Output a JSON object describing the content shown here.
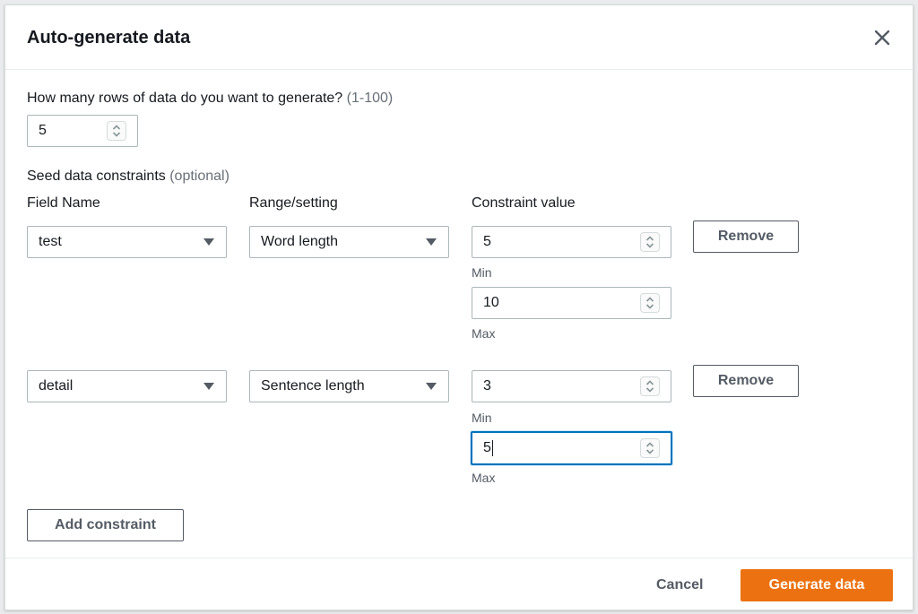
{
  "modal": {
    "title": "Auto-generate data",
    "close_icon": "close-icon"
  },
  "rows": {
    "question": "How many rows of data do you want to generate?",
    "range_hint": "(1-100)",
    "value": "5"
  },
  "constraints": {
    "heading": "Seed data constraints",
    "heading_hint": "(optional)",
    "col_field": "Field Name",
    "col_range": "Range/setting",
    "col_value": "Constraint value",
    "items": [
      {
        "field": "test",
        "setting": "Word length",
        "min": "5",
        "min_label": "Min",
        "max": "10",
        "max_label": "Max",
        "remove_label": "Remove"
      },
      {
        "field": "detail",
        "setting": "Sentence length",
        "min": "3",
        "min_label": "Min",
        "max": "5",
        "max_label": "Max",
        "remove_label": "Remove"
      }
    ],
    "add_label": "Add constraint"
  },
  "footer": {
    "cancel_label": "Cancel",
    "generate_label": "Generate data"
  },
  "colors": {
    "primary": "#ec7211",
    "focus": "#0073bb",
    "muted_text": "#687078"
  }
}
